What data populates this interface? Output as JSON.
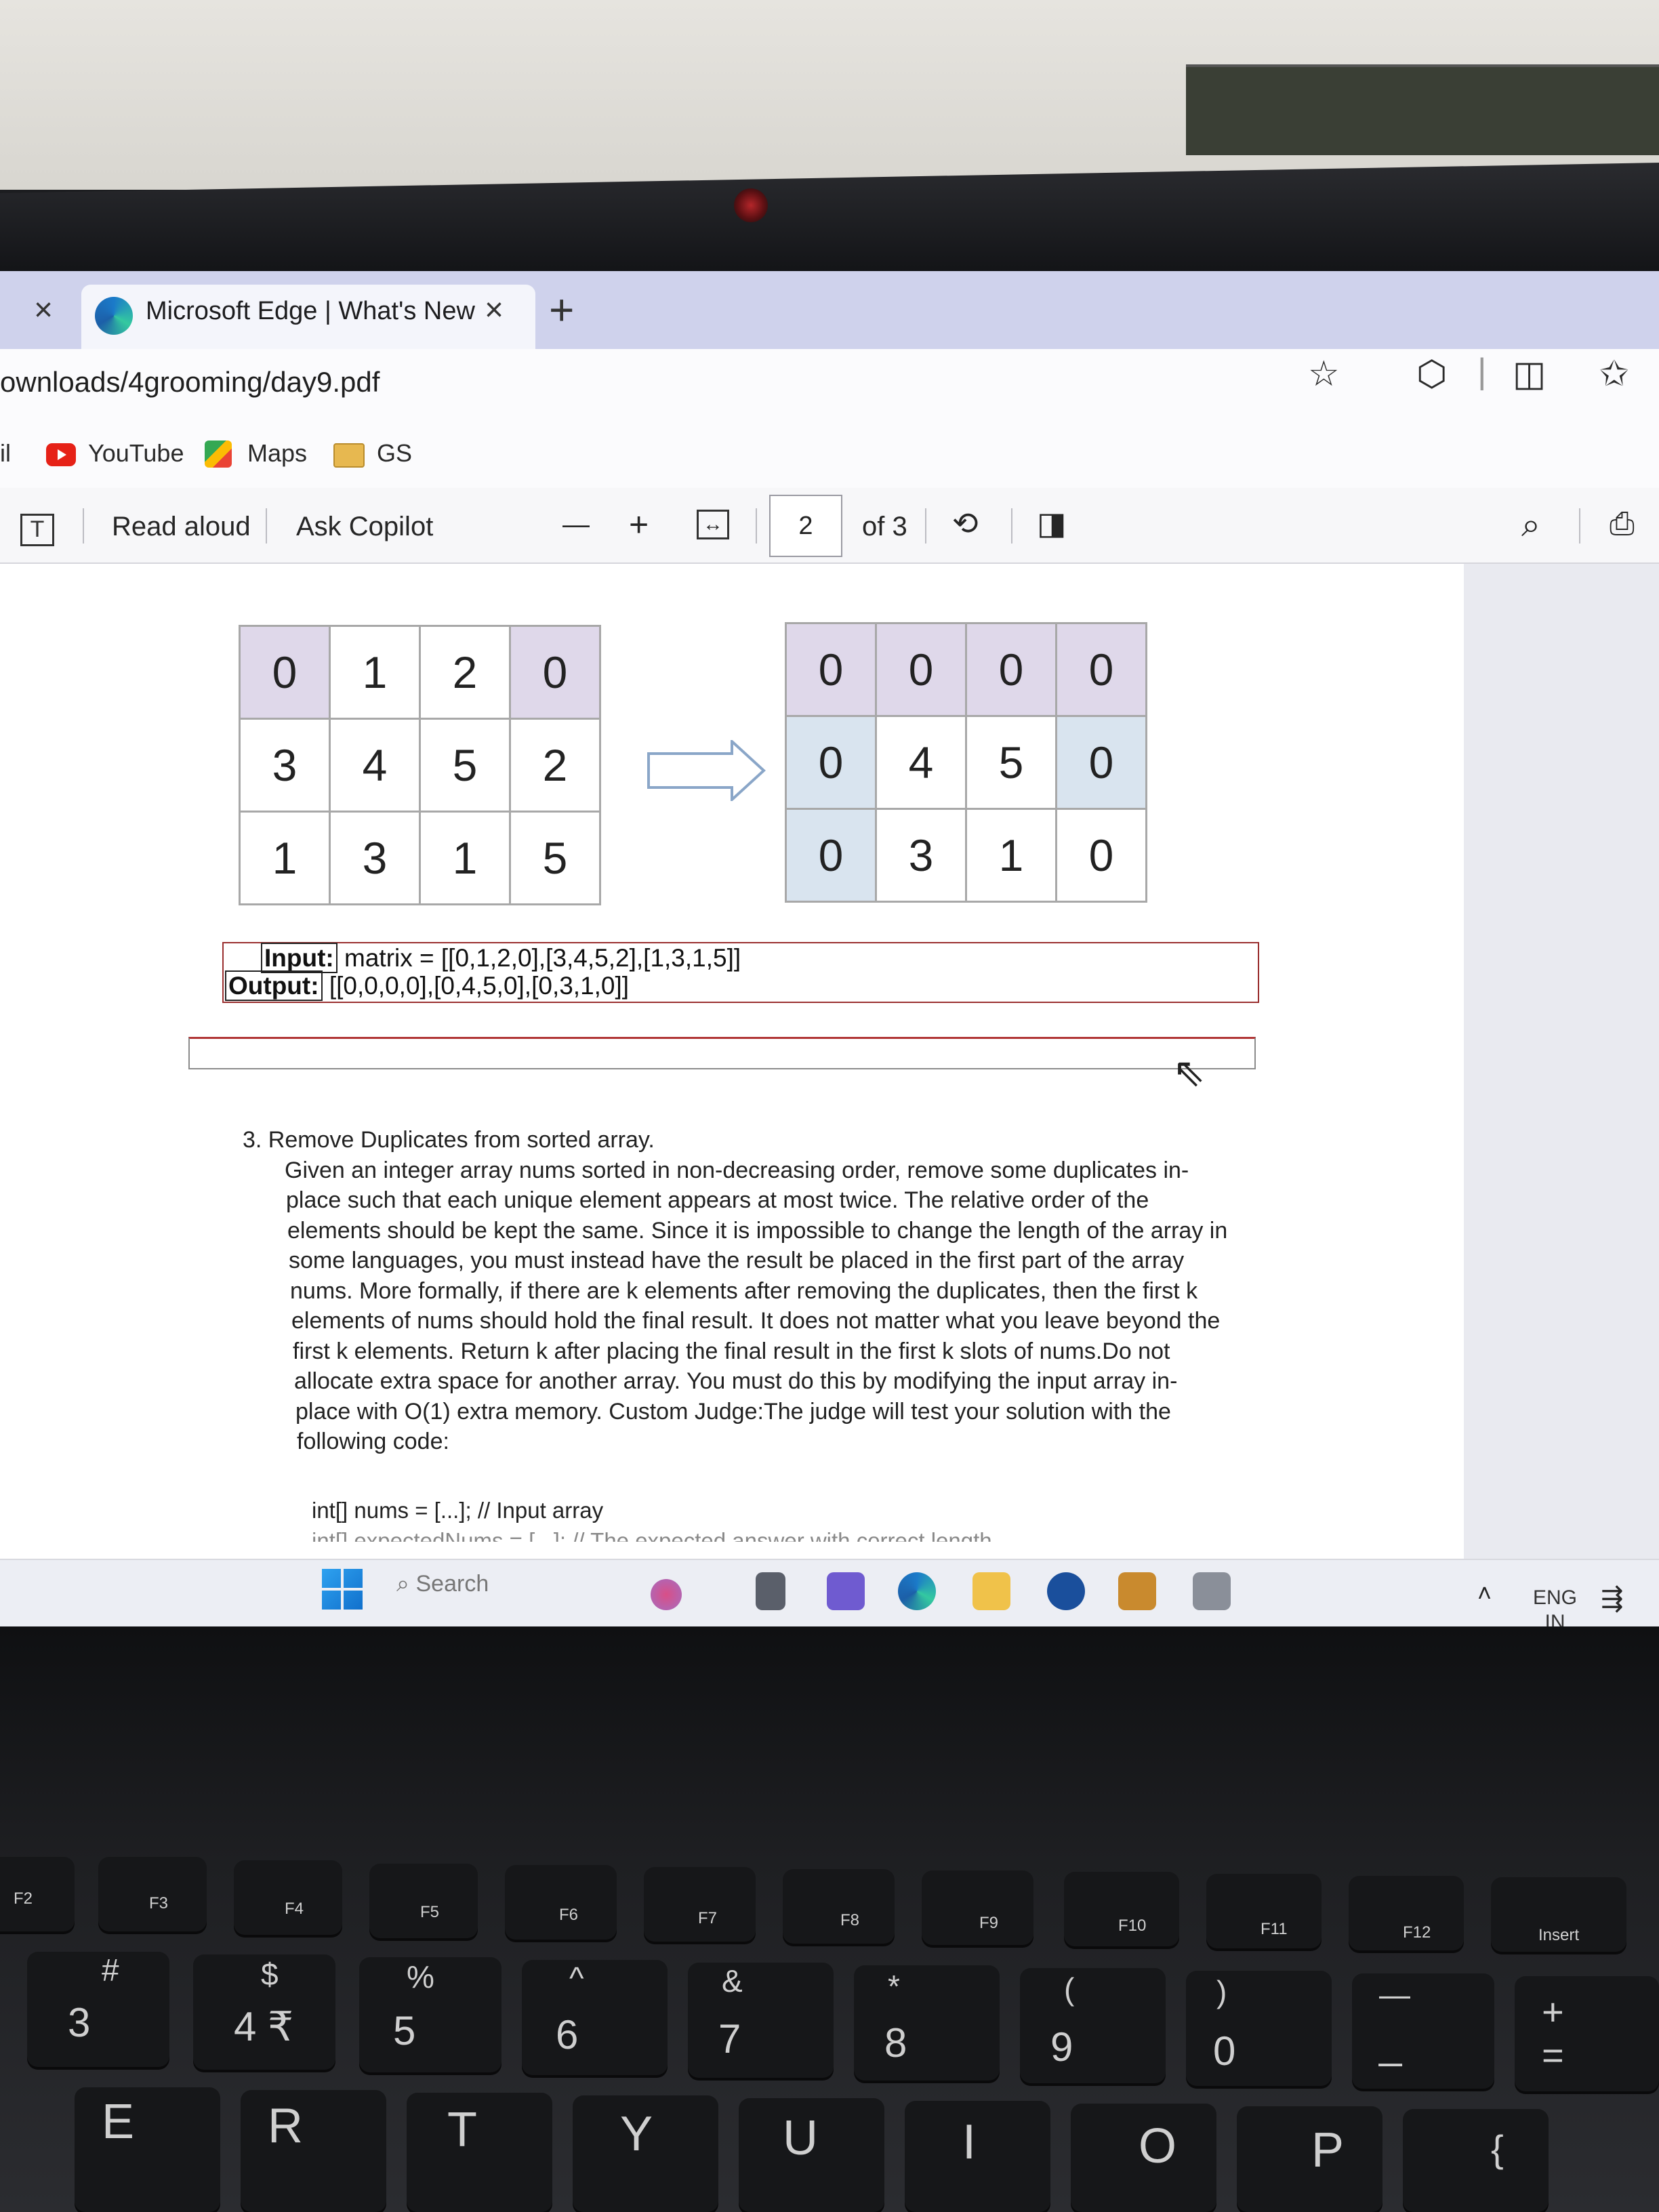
{
  "browser": {
    "prev_tab_close": "×",
    "tab_title": "Microsoft Edge | What's New",
    "tab_close": "×",
    "new_tab": "+",
    "url": "ownloads/4grooming/day9.pdf",
    "bookmarks": [
      {
        "label": "il"
      },
      {
        "label": "YouTube"
      },
      {
        "label": "Maps"
      },
      {
        "label": "GS"
      }
    ]
  },
  "pdf_toolbar": {
    "text_icon": "T",
    "read_aloud": "Read aloud",
    "ask_copilot": "Ask Copilot",
    "zoom_out": "—",
    "zoom_in": "+",
    "fit_icon": "↔",
    "page": "2",
    "of_pages": "of 3"
  },
  "matrix_before": [
    [
      "0",
      "1",
      "2",
      "0"
    ],
    [
      "3",
      "4",
      "5",
      "2"
    ],
    [
      "1",
      "3",
      "1",
      "5"
    ]
  ],
  "matrix_after": [
    [
      "0",
      "0",
      "0",
      "0"
    ],
    [
      "0",
      "4",
      "5",
      "0"
    ],
    [
      "0",
      "3",
      "1",
      "0"
    ]
  ],
  "example": {
    "input_label": "Input:",
    "input_value": " matrix = [[0,1,2,0],[3,4,5,2],[1,3,1,5]]",
    "output_label": "Output:",
    "output_value": " [[0,0,0,0],[0,4,5,0],[0,3,1,0]]"
  },
  "problem": {
    "lines": [
      "3.  Remove Duplicates from sorted array.",
      "Given an integer array nums sorted in non-decreasing order, remove some duplicates in-",
      "place such that each unique element appears at most twice. The relative order of the",
      "elements should be kept the same. Since it is impossible to change the length of the array in",
      "some languages, you must instead have the result be placed in the first part of the array",
      "nums. More formally, if there are k elements after removing the duplicates, then the first k",
      "elements of nums should hold the final result. It does not matter what you leave beyond the",
      "first k elements. Return k after placing the final result in the first k slots of nums.Do not",
      "allocate extra space for another array. You must do this by modifying the input array in-",
      "place with O(1) extra memory. Custom Judge:The judge will test your solution with the",
      "following code:"
    ],
    "code_line_1": "int[] nums = [...]; // Input array",
    "code_line_2": "int[] expectedNums = [...]; // The expected answer with correct length"
  },
  "taskbar": {
    "search_placeholder": "Search",
    "lang_1": "ENG",
    "lang_2": "IN"
  },
  "keyboard": {
    "fkeys": [
      "F2",
      "F3",
      "F4",
      "F5",
      "F6",
      "F7",
      "F8",
      "F9",
      "F10",
      "F11",
      "F12",
      "Insert"
    ],
    "number_row": [
      {
        "top": "#",
        "main": "3"
      },
      {
        "top": "$",
        "main": "4 ₹"
      },
      {
        "top": "%",
        "main": "5"
      },
      {
        "top": "^",
        "main": "6"
      },
      {
        "top": "&",
        "main": "7"
      },
      {
        "top": "*",
        "main": "8"
      },
      {
        "top": "(",
        "main": "9"
      },
      {
        "top": ")",
        "main": "0"
      },
      {
        "top": "—",
        "main": "_"
      },
      {
        "top": "+",
        "main": "="
      }
    ],
    "letter_row": [
      "E",
      "R",
      "T",
      "Y",
      "U",
      "I",
      "O",
      "P",
      "{"
    ]
  },
  "colors": {
    "tab_strip": "#cfd2ec",
    "matrix_highlight_purple": "#dfd8ea",
    "matrix_highlight_blue": "#d9e4ef",
    "example_border": "#9a2f2f"
  }
}
